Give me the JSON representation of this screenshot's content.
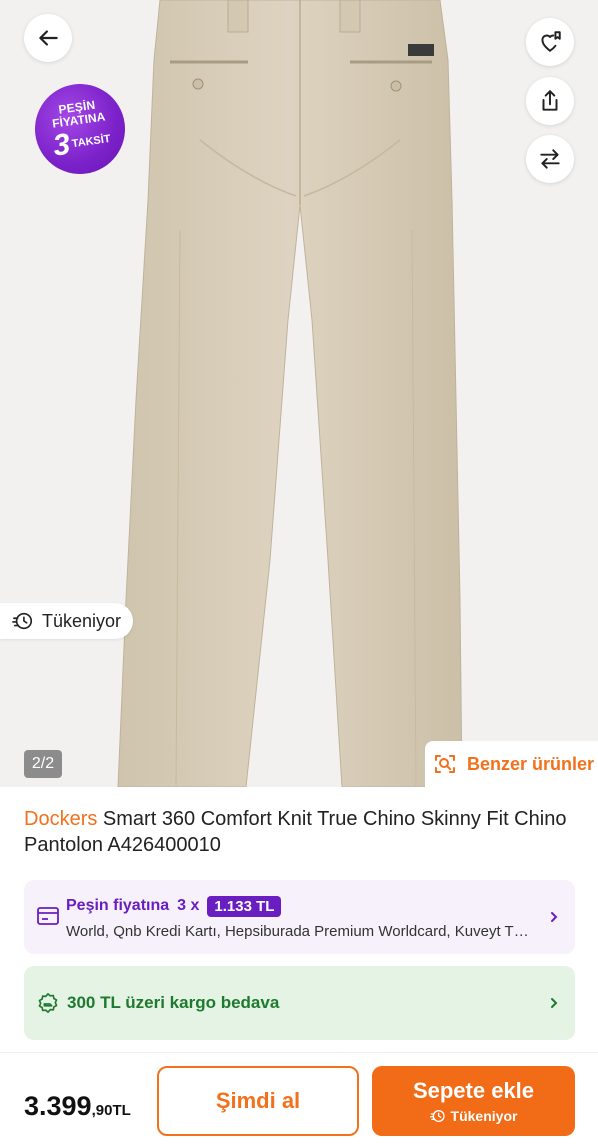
{
  "gallery": {
    "image_alt": "Beige chino pants, back view",
    "badge": {
      "line1": "PEŞİN",
      "line2": "FİYATINA",
      "number": "3",
      "line3": "TAKSİT"
    },
    "stock_status": "Tükeniyor",
    "page_indicator": "2/2",
    "similar_label": "Benzer ürünler",
    "icons": [
      "back-arrow-icon",
      "heart-list-icon",
      "share-icon",
      "compare-icon",
      "visual-search-icon",
      "flash-stock-icon"
    ]
  },
  "product": {
    "brand": "Dockers",
    "name": " Smart 360 Comfort Knit True Chino Skinny Fit Chino Pantolon A426400010"
  },
  "installment": {
    "label": "Peşin fiyatına",
    "multiplier": "3 x",
    "amount": "1.133 TL",
    "cards": "World, Qnb Kredi Kartı, Hepsiburada Premium Worldcard, Kuveyt Türk Sağlam Kart"
  },
  "shipping": {
    "text": "300 TL üzeri kargo bedava"
  },
  "bottom": {
    "price_main": "3.399",
    "price_decimal": ",90",
    "currency": "TL",
    "buy_now_label": "Şimdi al",
    "add_cart_label": "Sepete ekle",
    "add_cart_sub": "Tükeniyor"
  },
  "colors": {
    "accent_orange": "#f2711c",
    "purple": "#6a1ec2",
    "green": "#1e7a2e",
    "product_beige": "#d7cdb9"
  }
}
